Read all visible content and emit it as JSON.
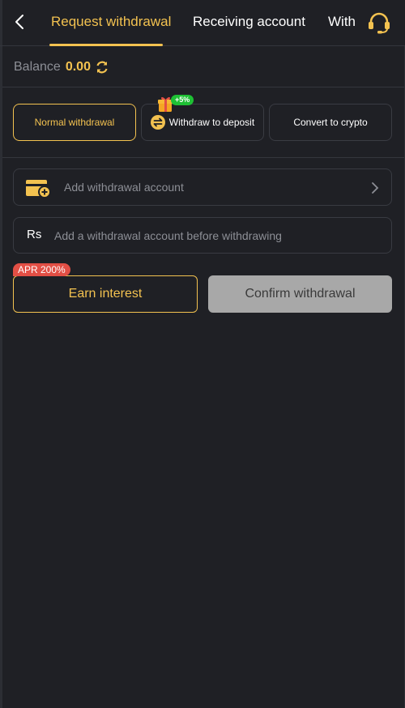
{
  "header": {
    "tabs": [
      {
        "label": "Request withdrawal",
        "active": true
      },
      {
        "label": "Receiving account",
        "active": false
      },
      {
        "label": "With",
        "active": false
      }
    ],
    "back_icon": "chevron-left-icon",
    "support_icon": "headset-icon"
  },
  "balance": {
    "label": "Balance",
    "value": "0.00",
    "refresh_icon": "refresh-icon"
  },
  "methods": [
    {
      "label": "Normal withdrawal",
      "active": true
    },
    {
      "label": "Withdraw to deposit",
      "active": false,
      "badge": "+5%"
    },
    {
      "label": "Convert to crypto",
      "active": false
    }
  ],
  "account_field": {
    "label": "Add withdrawal account",
    "icon": "wallet-add-icon"
  },
  "amount_field": {
    "currency_symbol": "Rs",
    "placeholder": "Add a withdrawal account before withdrawing"
  },
  "actions": {
    "earn_badge": "APR 200%",
    "earn_label": "Earn interest",
    "confirm_label": "Confirm withdrawal"
  },
  "colors": {
    "accent": "#f3c250",
    "background": "#1f2025",
    "badge_green": "#1ec034",
    "badge_red": "#e24f45",
    "disabled_button": "#a8a8a8"
  }
}
